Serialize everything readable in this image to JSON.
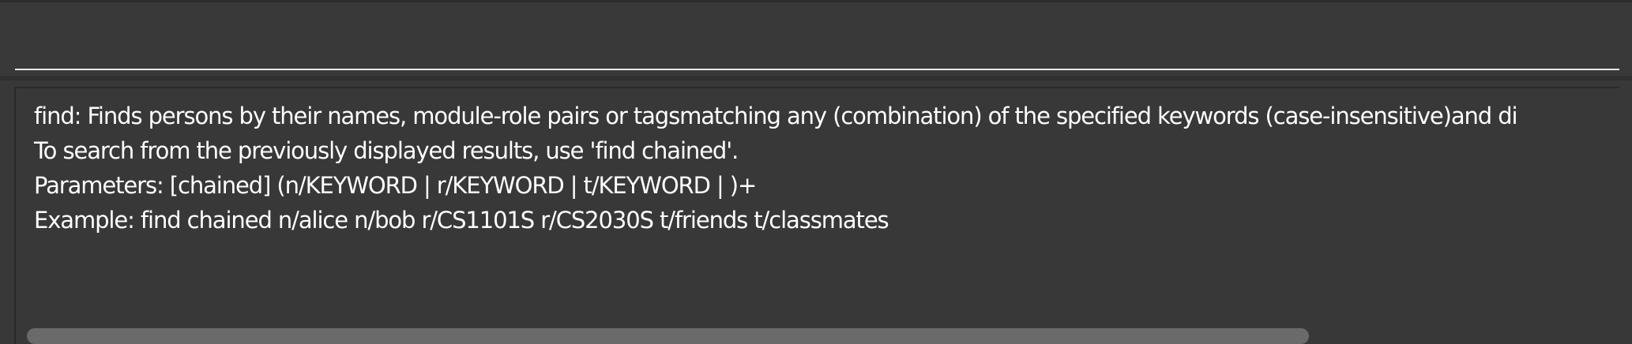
{
  "command_box": {
    "value": "",
    "placeholder": ""
  },
  "result_display": {
    "lines": [
      "find: Finds persons by their names, module-role pairs or tagsmatching any (combination) of the specified keywords (case-insensitive)and di",
      "To search from the previously displayed results, use 'find chained'.",
      "Parameters: [chained] (n/KEYWORD | r/KEYWORD | t/KEYWORD | )+",
      "Example: find chained n/alice n/bob r/CS1101S r/CS2030S t/friends t/classmates"
    ]
  },
  "colors": {
    "background": "#383838",
    "text": "#ffffff",
    "command_underline": "#e8e8e8",
    "scrollbar_thumb": "#6a6a6a"
  }
}
